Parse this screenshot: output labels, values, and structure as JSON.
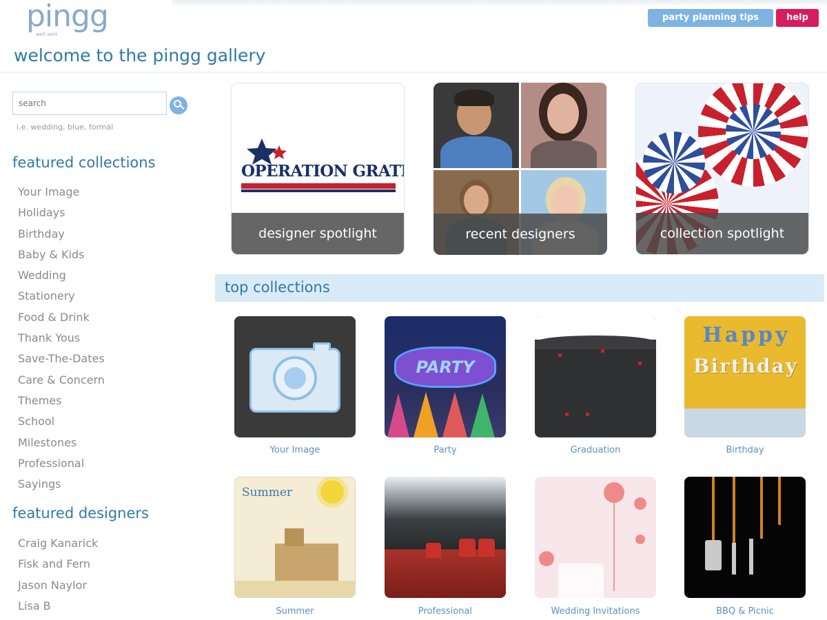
{
  "header": {
    "logo": "pingg",
    "logo_tagline": "well sent",
    "party_tips_label": "party planning tips",
    "help_label": "help",
    "page_title": "welcome to the pingg gallery"
  },
  "search": {
    "placeholder": "search",
    "hint": "i.e. wedding, blue, formal"
  },
  "sidebar": {
    "featured_collections_heading": "featured collections",
    "collections": [
      "Your Image",
      "Holidays",
      "Birthday",
      "Baby & Kids",
      "Wedding",
      "Stationery",
      "Food & Drink",
      "Thank Yous",
      "Save-The-Dates",
      "Care & Concern",
      "Themes",
      "School",
      "Milestones",
      "Professional",
      "Sayings"
    ],
    "featured_designers_heading": "featured designers",
    "designers": [
      "Craig Kanarick",
      "Fisk and Fern",
      "Jason Naylor",
      "Lisa B"
    ]
  },
  "spotlights": {
    "designer_spotlight": "designer spotlight",
    "designer_logo_text": "OPERATION GRATITUDE",
    "recent_designers": "recent designers",
    "collection_spotlight": "collection spotlight"
  },
  "top_collections": {
    "heading": "top collections",
    "items": [
      "Your Image",
      "Party",
      "Graduation",
      "Birthday",
      "Summer",
      "Professional",
      "Wedding Invitations",
      "BBQ & Picnic"
    ],
    "tile_text": {
      "happy": "Happy",
      "birthday": "Birthday",
      "summer": "Summer",
      "balloon": "PARTY"
    }
  },
  "colors": {
    "accent_blue": "#2f79a8",
    "button_blue": "#7db3e3",
    "help_pink": "#d91c5c",
    "band": "#d9ebf7"
  }
}
